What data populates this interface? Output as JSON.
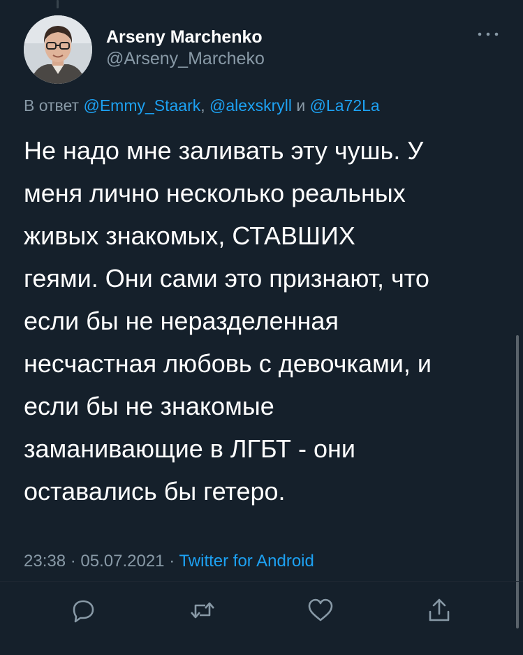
{
  "tweet": {
    "display_name": "Arseny Marchenko",
    "handle": "@Arseny_Marcheko",
    "reply_prefix": "В ответ",
    "mentions": [
      "@Emmy_Staark",
      "@alexskryll",
      "@La72La"
    ],
    "mention_separator": ",",
    "mention_conjunction": "и",
    "text_lines": [
      "Не надо мне заливать эту чушь. У",
      "меня лично несколько реальных",
      "живых знакомых, СТАВШИХ",
      "геями. Они сами это признают, что",
      "если бы не неразделенная",
      "несчастная любовь с девочками, и",
      "если бы не знакомые",
      "заманивающие в ЛГБТ - они",
      "оставались бы гетеро."
    ],
    "time": "23:38",
    "date": "05.07.2021",
    "meta_separator": "·",
    "source": "Twitter for Android"
  },
  "actions": [
    {
      "name": "reply",
      "icon": "reply-icon"
    },
    {
      "name": "retweet",
      "icon": "retweet-icon"
    },
    {
      "name": "like",
      "icon": "heart-icon"
    },
    {
      "name": "share",
      "icon": "share-icon"
    }
  ],
  "colors": {
    "background": "#15202b",
    "text": "#ffffff",
    "secondary": "#8899a6",
    "link": "#1da1f2"
  }
}
